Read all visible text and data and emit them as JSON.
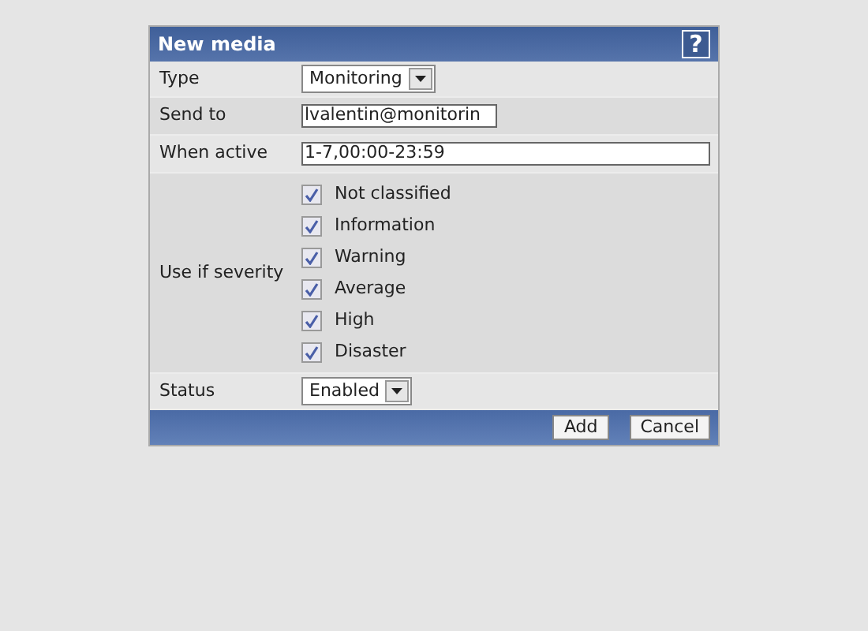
{
  "dialog": {
    "title": "New media",
    "help": "?"
  },
  "fields": [
    {
      "kind": "select",
      "label": "Type",
      "value": "Monitoring"
    },
    {
      "kind": "text",
      "label": "Send to",
      "value": "lvalentin@monitorin"
    },
    {
      "kind": "text",
      "label": "When active",
      "value": "1-7,00:00-23:59"
    },
    {
      "kind": "checks",
      "label": "Use if severity",
      "options": [
        {
          "label": "Not classified",
          "checked": true
        },
        {
          "label": "Information",
          "checked": true
        },
        {
          "label": "Warning",
          "checked": true
        },
        {
          "label": "Average",
          "checked": true
        },
        {
          "label": "High",
          "checked": true
        },
        {
          "label": "Disaster",
          "checked": true
        }
      ]
    },
    {
      "kind": "select",
      "label": "Status",
      "value": "Enabled"
    }
  ],
  "buttons": [
    "Add",
    "Cancel"
  ]
}
